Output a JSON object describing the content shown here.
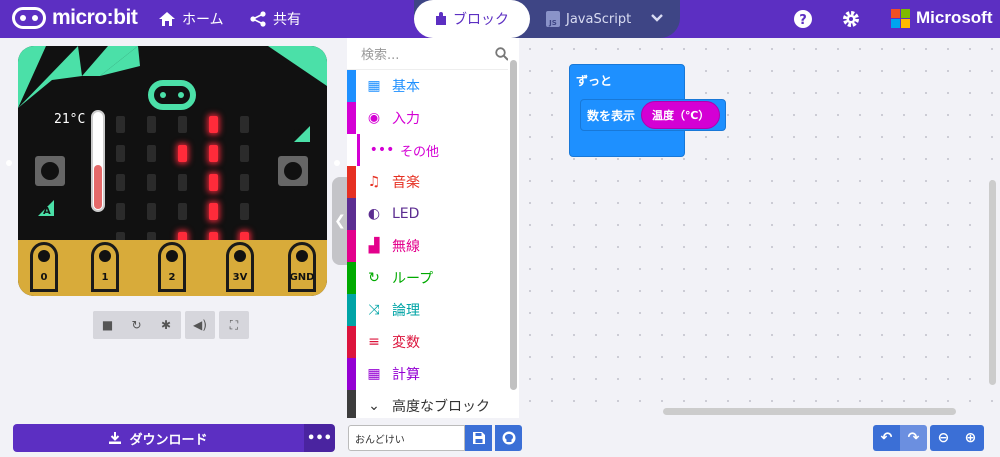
{
  "topbar": {
    "logo_text": "micro:bit",
    "home_label": "ホーム",
    "share_label": "共有",
    "tab_blocks": "ブロック",
    "tab_javascript": "JavaScript",
    "brand": "Microsoft",
    "icons": [
      "home-icon",
      "share-icon",
      "puzzle-icon",
      "chevron-down-icon",
      "help-icon",
      "gear-icon"
    ]
  },
  "simulator": {
    "temperature_label": "21°C",
    "temperature_level": 0.46,
    "button_a": "A",
    "button_b": "B",
    "pins": [
      "0",
      "1",
      "2",
      "3V",
      "GND"
    ],
    "led_matrix": [
      [
        0,
        0,
        0,
        1,
        0
      ],
      [
        0,
        0,
        1,
        1,
        0
      ],
      [
        0,
        0,
        0,
        1,
        0
      ],
      [
        0,
        0,
        0,
        1,
        0
      ],
      [
        0,
        0,
        1,
        1,
        1
      ]
    ],
    "toolbar_icons": [
      "stop-icon",
      "restart-icon",
      "debug-icon",
      "sound-icon",
      "fullscreen-icon"
    ]
  },
  "toolbox": {
    "search_placeholder": "検索...",
    "categories": [
      {
        "label": "基本",
        "color": "#1e90ff",
        "icon": "grid-icon",
        "glyph": "▦"
      },
      {
        "label": "入力",
        "color": "#d400d4",
        "icon": "input-icon",
        "glyph": "◉"
      },
      {
        "label": "その他",
        "color": "#d400d4",
        "icon": "more-icon",
        "glyph": "•••"
      },
      {
        "label": "音楽",
        "color": "#e63022",
        "icon": "headphones-icon",
        "glyph": "♫"
      },
      {
        "label": "LED",
        "color": "#5c2d91",
        "icon": "toggle-icon",
        "glyph": "◐"
      },
      {
        "label": "無線",
        "color": "#e3008c",
        "icon": "signal-icon",
        "glyph": "▟"
      },
      {
        "label": "ループ",
        "color": "#00aa00",
        "icon": "loop-icon",
        "glyph": "↻"
      },
      {
        "label": "論理",
        "color": "#00a4a6",
        "icon": "shuffle-icon",
        "glyph": "⤨"
      },
      {
        "label": "変数",
        "color": "#dc143c",
        "icon": "list-icon",
        "glyph": "≡"
      },
      {
        "label": "計算",
        "color": "#9400d3",
        "icon": "calculator-icon",
        "glyph": "▦"
      },
      {
        "label": "高度なブロック",
        "color": "#3c3c3c",
        "icon": "chevron-down-icon",
        "glyph": "⌄"
      }
    ]
  },
  "workspace": {
    "forever_label": "ずっと",
    "show_number_label": "数を表示",
    "temperature_reporter": "温度（℃）"
  },
  "bottombar": {
    "download_label": "ダウンロード",
    "more_label": "•••",
    "project_name": "おんどけい",
    "icons": [
      "download-icon",
      "save-icon",
      "github-icon",
      "undo-icon",
      "redo-icon",
      "zoom-out-icon",
      "zoom-in-icon"
    ]
  }
}
